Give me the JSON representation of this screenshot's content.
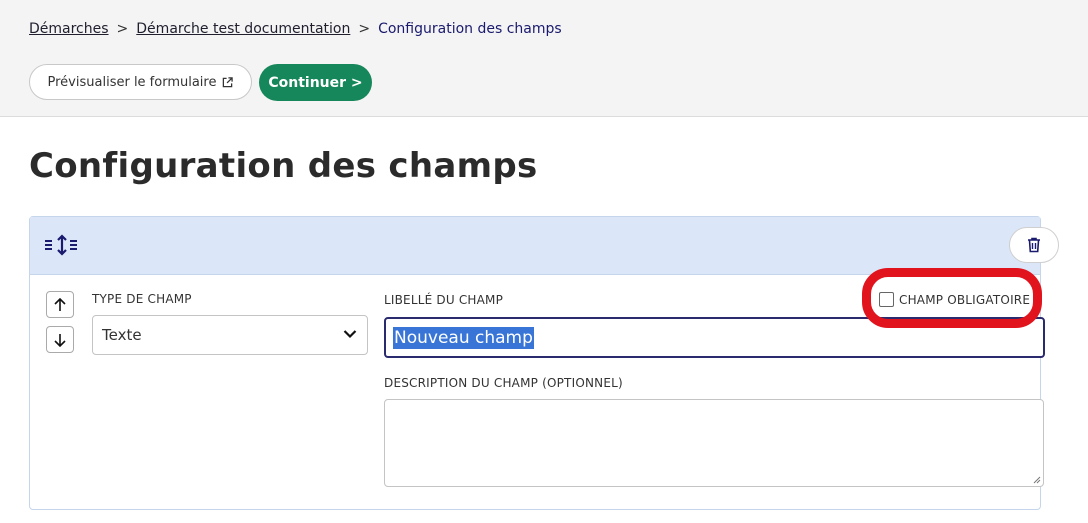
{
  "breadcrumb": {
    "item1": "Démarches",
    "item2": "Démarche test documentation",
    "current": "Configuration des champs",
    "separator": ">"
  },
  "toolbar": {
    "preview_label": "Prévisualiser le formulaire",
    "preview_icon": "external-link-icon",
    "continue_label": "Continuer >"
  },
  "page": {
    "title": "Configuration des champs"
  },
  "field_card": {
    "drag_icon": "drag-handle-icon",
    "delete_icon": "trash-icon",
    "type_label": "TYPE DE CHAMP",
    "type_value": "Texte",
    "name_label": "LIBELLÉ DU CHAMP",
    "name_value": "Nouveau champ",
    "required_label": "CHAMP OBLIGATOIRE",
    "required_checked": false,
    "description_label": "DESCRIPTION DU CHAMP (OPTIONNEL)",
    "description_value": ""
  },
  "colors": {
    "accent_green": "#16875a",
    "header_blue": "#dbe7f8",
    "annotation_red": "#e1141e",
    "focus_navy": "#2a2a6e"
  }
}
